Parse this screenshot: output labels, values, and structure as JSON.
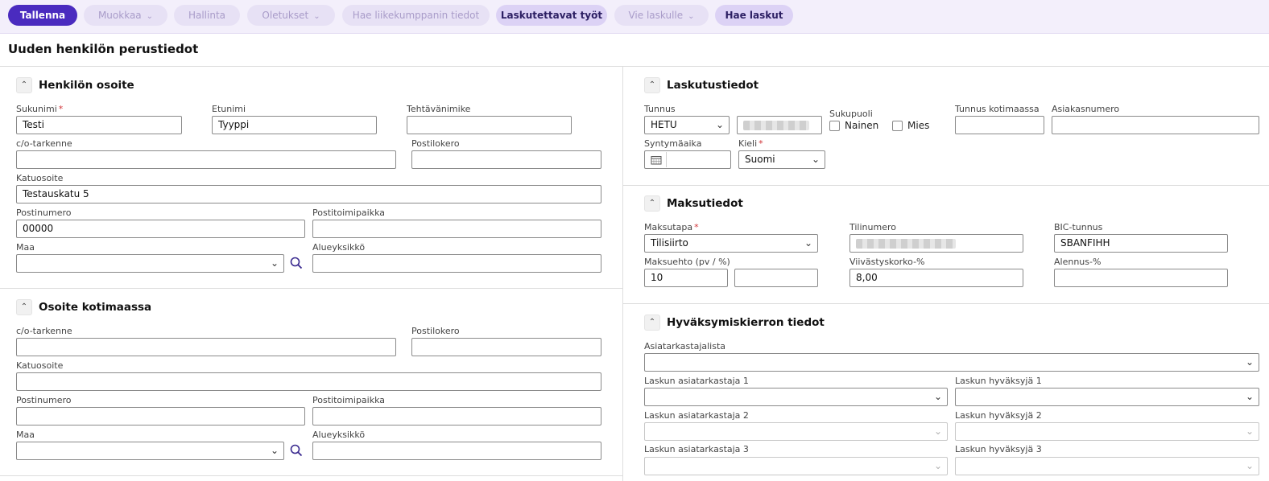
{
  "toolbar": {
    "save": "Tallenna",
    "edit": "Muokkaa",
    "manage": "Hallinta",
    "defaults": "Oletukset",
    "fetch_partner": "Hae liikekumppanin tiedot",
    "billable_work": "Laskutettavat työt",
    "send_to_invoice": "Vie laskulle",
    "fetch_invoices": "Hae laskut"
  },
  "page_title": "Uuden henkilön perustiedot",
  "person_address": {
    "title": "Henkilön osoite",
    "lastname_label": "Sukunimi",
    "lastname_value": "Testi",
    "firstname_label": "Etunimi",
    "firstname_value": "Tyyppi",
    "jobtitle_label": "Tehtävänimike",
    "co_label": "c/o-tarkenne",
    "pobox_label": "Postilokero",
    "street_label": "Katuosoite",
    "street_value": "Testauskatu 5",
    "zip_label": "Postinumero",
    "zip_value": "00000",
    "city_label": "Postitoimipaikka",
    "country_label": "Maa",
    "region_label": "Alueyksikkö"
  },
  "home_address": {
    "title": "Osoite kotimaassa",
    "co_label": "c/o-tarkenne",
    "pobox_label": "Postilokero",
    "street_label": "Katuosoite",
    "zip_label": "Postinumero",
    "city_label": "Postitoimipaikka",
    "country_label": "Maa",
    "region_label": "Alueyksikkö"
  },
  "billing": {
    "title": "Laskutustiedot",
    "id_label": "Tunnus",
    "id_type": "HETU",
    "gender_label": "Sukupuoli",
    "female": "Nainen",
    "male": "Mies",
    "home_id_label": "Tunnus kotimaassa",
    "customer_no_label": "Asiakasnumero",
    "birthdate_label": "Syntymäaika",
    "language_label": "Kieli",
    "language_value": "Suomi"
  },
  "payment": {
    "title": "Maksutiedot",
    "method_label": "Maksutapa",
    "method_value": "Tilisiirto",
    "account_label": "Tilinumero",
    "bic_label": "BIC-tunnus",
    "bic_value": "SBANFIHH",
    "terms_label": "Maksuehto (pv / %)",
    "terms_days": "10",
    "late_label": "Viivästyskorko-%",
    "late_value": "8,00",
    "discount_label": "Alennus-%"
  },
  "approval": {
    "title": "Hyväksymiskierron tiedot",
    "reviewer_list_label": "Asiatarkastajalista",
    "reviewer1_label": "Laskun asiatarkastaja 1",
    "approver1_label": "Laskun hyväksyjä 1",
    "reviewer2_label": "Laskun asiatarkastaja 2",
    "approver2_label": "Laskun hyväksyjä 2",
    "reviewer3_label": "Laskun asiatarkastaja 3",
    "approver3_label": "Laskun hyväksyjä 3"
  },
  "colors": {
    "primary": "#4a2bbf",
    "toolbar_bg": "#f3effb",
    "required": "#d13438"
  },
  "icons": {
    "collapse": "chevron-up-icon",
    "dropdown": "chevron-down-icon",
    "search": "search-icon",
    "calendar": "calendar-icon"
  }
}
